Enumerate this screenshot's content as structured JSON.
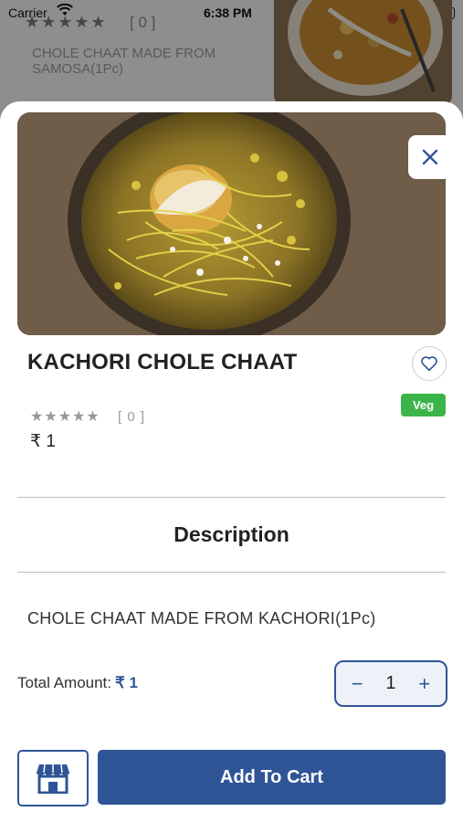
{
  "status_bar": {
    "carrier": "Carrier",
    "time": "6:38 PM"
  },
  "background": {
    "stars": "★★★★★",
    "rating_count": "[ 0 ]",
    "description": "CHOLE CHAAT MADE FROM SAMOSA(1Pc)"
  },
  "product": {
    "title": "KACHORI CHOLE CHAAT",
    "badge": "Veg",
    "stars": "★★★★★",
    "rating_count": "[ 0 ]",
    "price": "₹ 1"
  },
  "description": {
    "heading": "Description",
    "text": "CHOLE CHAAT MADE FROM KACHORI(1Pc)"
  },
  "total": {
    "label": "Total Amount:",
    "value": "₹ 1"
  },
  "quantity": {
    "minus": "−",
    "value": "1",
    "plus": "+"
  },
  "actions": {
    "add_to_cart": "Add To Cart"
  },
  "colors": {
    "primary": "#2f5597",
    "veg_badge": "#3bb54a"
  },
  "icons": [
    "wifi-icon",
    "battery-icon",
    "close-icon",
    "heart-icon",
    "store-icon"
  ]
}
